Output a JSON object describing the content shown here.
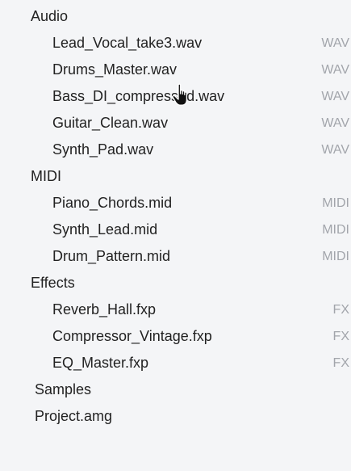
{
  "tree": {
    "audio": {
      "label": "Audio",
      "files": [
        {
          "name": "Lead_Vocal_take3.wav",
          "type": "WAV"
        },
        {
          "name": "Drums_Master.wav",
          "type": "WAV"
        },
        {
          "name": "Bass_DI_compressed.wav",
          "type": "WAV"
        },
        {
          "name": "Guitar_Clean.wav",
          "type": "WAV"
        },
        {
          "name": "Synth_Pad.wav",
          "type": "WAV"
        }
      ]
    },
    "midi": {
      "label": "MIDI",
      "files": [
        {
          "name": "Piano_Chords.mid",
          "type": "MIDI"
        },
        {
          "name": "Synth_Lead.mid",
          "type": "MIDI"
        },
        {
          "name": "Drum_Pattern.mid",
          "type": "MIDI"
        }
      ]
    },
    "effects": {
      "label": "Effects",
      "files": [
        {
          "name": "Reverb_Hall.fxp",
          "type": "FX"
        },
        {
          "name": "Compressor_Vintage.fxp",
          "type": "FX"
        },
        {
          "name": "EQ_Master.fxp",
          "type": "FX"
        }
      ]
    },
    "root_items": [
      {
        "name": "Samples"
      },
      {
        "name": "Project.amg"
      }
    ]
  },
  "cursor": {
    "icon": "hand-pointer-icon"
  },
  "colors": {
    "background": "#f4f5f7",
    "text": "#222222",
    "type_tag": "#a2a5ab"
  }
}
